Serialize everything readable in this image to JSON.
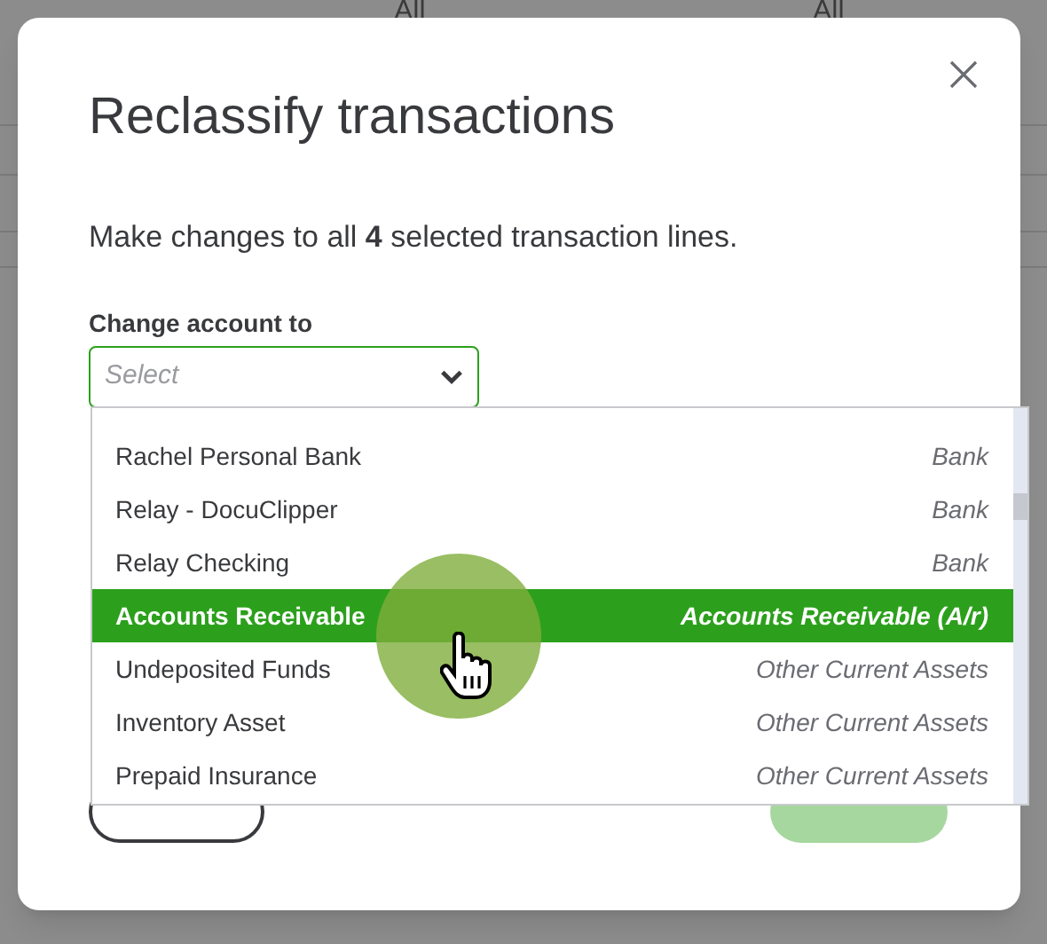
{
  "background": {
    "filters": [
      "All",
      "All"
    ]
  },
  "dialog": {
    "title": "Reclassify transactions",
    "message": "Make changes to all **4** selected transaction lines.",
    "field": {
      "label": "Change account to",
      "placeholder": "Select",
      "expanded": true
    },
    "options": [
      {
        "name": "Rachel Personal Bank",
        "type": "Bank",
        "selected": false
      },
      {
        "name": "Relay - DocuClipper",
        "type": "Bank",
        "selected": false
      },
      {
        "name": "Relay Checking",
        "type": "Bank",
        "selected": false
      },
      {
        "name": "Accounts Receivable",
        "type": "Accounts Receivable (A/r)",
        "selected": true
      },
      {
        "name": "Undeposited Funds",
        "type": "Other Current Assets",
        "selected": false
      },
      {
        "name": "Inventory Asset",
        "type": "Other Current Assets",
        "selected": false
      },
      {
        "name": "Prepaid Insurance",
        "type": "Other Current Assets",
        "selected": false
      }
    ],
    "buttons": [
      {
        "kind": "secondary",
        "disabled": false
      },
      {
        "kind": "primary",
        "disabled": true
      }
    ]
  }
}
